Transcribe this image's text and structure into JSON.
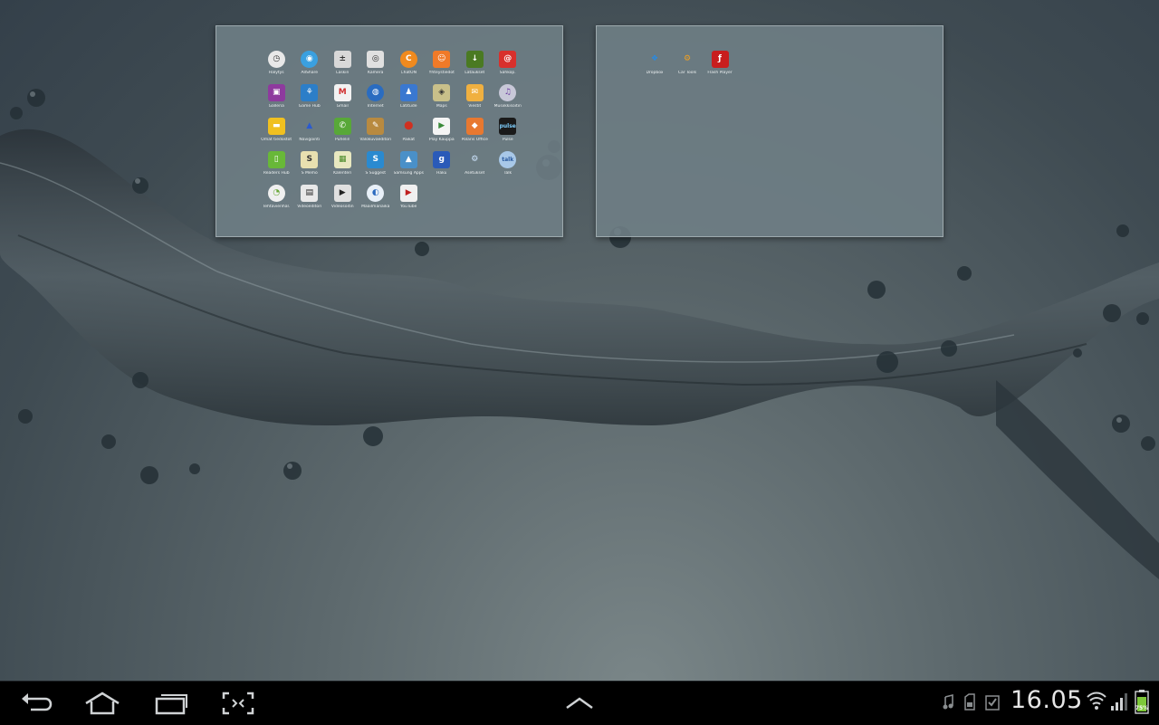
{
  "home_panels": [
    {
      "apps": [
        {
          "label": "Hälytys",
          "icon": "clock-icon",
          "bg": "#e8e8e8",
          "fg": "#333",
          "glyph": "◷",
          "round": true
        },
        {
          "label": "AllShare",
          "icon": "allshare-icon",
          "bg": "#3aa0e0",
          "fg": "#fff",
          "glyph": "◉",
          "round": true
        },
        {
          "label": "Laskin",
          "icon": "calculator-icon",
          "bg": "#d8d8d8",
          "fg": "#333",
          "glyph": "±",
          "round": false
        },
        {
          "label": "Kamera",
          "icon": "camera-icon",
          "bg": "#e0e0e0",
          "fg": "#222",
          "glyph": "◎",
          "round": false
        },
        {
          "label": "ChatON",
          "icon": "chaton-icon",
          "bg": "#f08a1e",
          "fg": "#fff",
          "glyph": "C",
          "round": true
        },
        {
          "label": "Yhteystiedot",
          "icon": "contacts-icon",
          "bg": "#f07a28",
          "fg": "#fff",
          "glyph": "☺",
          "round": false
        },
        {
          "label": "Lataukset",
          "icon": "downloads-icon",
          "bg": "#4a7a22",
          "fg": "#fff",
          "glyph": "↓",
          "round": false
        },
        {
          "label": "Sähköp.",
          "icon": "email-icon",
          "bg": "#d8302c",
          "fg": "#fff",
          "glyph": "@",
          "round": false
        },
        {
          "label": "Galleria",
          "icon": "gallery-icon",
          "bg": "#8e3a9e",
          "fg": "#fff",
          "glyph": "▣",
          "round": false
        },
        {
          "label": "Game Hub",
          "icon": "gamehub-icon",
          "bg": "#2c7ec8",
          "fg": "#fff",
          "glyph": "⚘",
          "round": false
        },
        {
          "label": "Gmail",
          "icon": "gmail-icon",
          "bg": "#f2f2f2",
          "fg": "#d03030",
          "glyph": "M",
          "round": false
        },
        {
          "label": "Internet",
          "icon": "internet-globe-icon",
          "bg": "#2a6cc0",
          "fg": "#fff",
          "glyph": "◍",
          "round": true
        },
        {
          "label": "Latitude",
          "icon": "latitude-icon",
          "bg": "#3a78d0",
          "fg": "#fff",
          "glyph": "♟",
          "round": false
        },
        {
          "label": "Maps",
          "icon": "maps-icon",
          "bg": "#c9c08a",
          "fg": "#333",
          "glyph": "◈",
          "round": false
        },
        {
          "label": "Viestit",
          "icon": "messages-icon",
          "bg": "#f0b040",
          "fg": "#fff",
          "glyph": "✉",
          "round": false
        },
        {
          "label": "Musiikkisoitin",
          "icon": "music-player-icon",
          "bg": "#c8c8d8",
          "fg": "#6a3a9e",
          "glyph": "♫",
          "round": true
        },
        {
          "label": "Omat tiedostot",
          "icon": "my-files-icon",
          "bg": "#f0c020",
          "fg": "#fff",
          "glyph": "▬",
          "round": false
        },
        {
          "label": "Navigointi",
          "icon": "navigation-icon",
          "bg": "transparent",
          "fg": "#2a5ad0",
          "glyph": "▲",
          "round": false
        },
        {
          "label": "Puhelin",
          "icon": "phone-icon",
          "bg": "#58a838",
          "fg": "#fff",
          "glyph": "✆",
          "round": false
        },
        {
          "label": "Valokuvaeditori",
          "icon": "photo-editor-icon",
          "bg": "#b88a40",
          "fg": "#fff",
          "glyph": "✎",
          "round": false
        },
        {
          "label": "Paikat",
          "icon": "places-icon",
          "bg": "transparent",
          "fg": "#d03020",
          "glyph": "⬤",
          "round": false
        },
        {
          "label": "Play Kauppa",
          "icon": "play-store-icon",
          "bg": "#f4f4f4",
          "fg": "#3a8a3a",
          "glyph": "▶",
          "round": false
        },
        {
          "label": "Polaris Office",
          "icon": "polaris-office-icon",
          "bg": "#e87830",
          "fg": "#fff",
          "glyph": "◆",
          "round": false
        },
        {
          "label": "Pulse",
          "icon": "pulse-icon",
          "bg": "#1a1a1a",
          "fg": "#7fd0ff",
          "glyph": "pulse",
          "round": false
        },
        {
          "label": "Readers Hub",
          "icon": "readers-hub-icon",
          "bg": "#68b838",
          "fg": "#fff",
          "glyph": "▯",
          "round": false
        },
        {
          "label": "S Memo",
          "icon": "s-memo-icon",
          "bg": "#e8e0b0",
          "fg": "#333",
          "glyph": "S",
          "round": false
        },
        {
          "label": "Kalenteri",
          "icon": "calendar-icon",
          "bg": "#e8e8c0",
          "fg": "#4a8a2a",
          "glyph": "▦",
          "round": false
        },
        {
          "label": "S Suggest",
          "icon": "s-suggest-icon",
          "bg": "#2a8ad0",
          "fg": "#fff",
          "glyph": "S",
          "round": false
        },
        {
          "label": "Samsung Apps",
          "icon": "samsung-apps-icon",
          "bg": "#4a90c8",
          "fg": "#fff",
          "glyph": "▲",
          "round": false
        },
        {
          "label": "Haku",
          "icon": "google-search-icon",
          "bg": "#2a5ab8",
          "fg": "#fff",
          "glyph": "g",
          "round": false
        },
        {
          "label": "Asetukset",
          "icon": "settings-gear-icon",
          "bg": "transparent",
          "fg": "#cfe6ff",
          "glyph": "⚙",
          "round": false
        },
        {
          "label": "Talk",
          "icon": "talk-icon",
          "bg": "#a8c8e8",
          "fg": "#2a5a9e",
          "glyph": "talk",
          "round": true
        },
        {
          "label": "Tehtävienhal.",
          "icon": "task-manager-icon",
          "bg": "#f0f0f0",
          "fg": "#6aa838",
          "glyph": "◔",
          "round": true
        },
        {
          "label": "Videoeditori",
          "icon": "video-editor-icon",
          "bg": "#e8e8e8",
          "fg": "#222",
          "glyph": "▤",
          "round": false
        },
        {
          "label": "Videosoitin",
          "icon": "video-player-icon",
          "bg": "#e0e0e0",
          "fg": "#222",
          "glyph": "▶",
          "round": false
        },
        {
          "label": "Maailmanaika",
          "icon": "world-clock-icon",
          "bg": "#e8f0f8",
          "fg": "#2a6ac0",
          "glyph": "◐",
          "round": true
        },
        {
          "label": "YouTube",
          "icon": "youtube-icon",
          "bg": "#f0f0f0",
          "fg": "#c02020",
          "glyph": "▶",
          "round": false
        }
      ]
    },
    {
      "apps": [
        {
          "label": "Dropbox",
          "icon": "dropbox-icon",
          "bg": "transparent",
          "fg": "#2a8ae0",
          "glyph": "❖",
          "round": false
        },
        {
          "label": "Car Tools",
          "icon": "car-tools-gear-icon",
          "bg": "transparent",
          "fg": "#f0a020",
          "glyph": "⚙",
          "round": false
        },
        {
          "label": "Flash Player",
          "icon": "flash-player-icon",
          "bg": "#c81e1e",
          "fg": "#fff",
          "glyph": "ƒ",
          "round": false
        }
      ]
    }
  ],
  "status_bar": {
    "time": "16.05",
    "battery": "75%"
  }
}
